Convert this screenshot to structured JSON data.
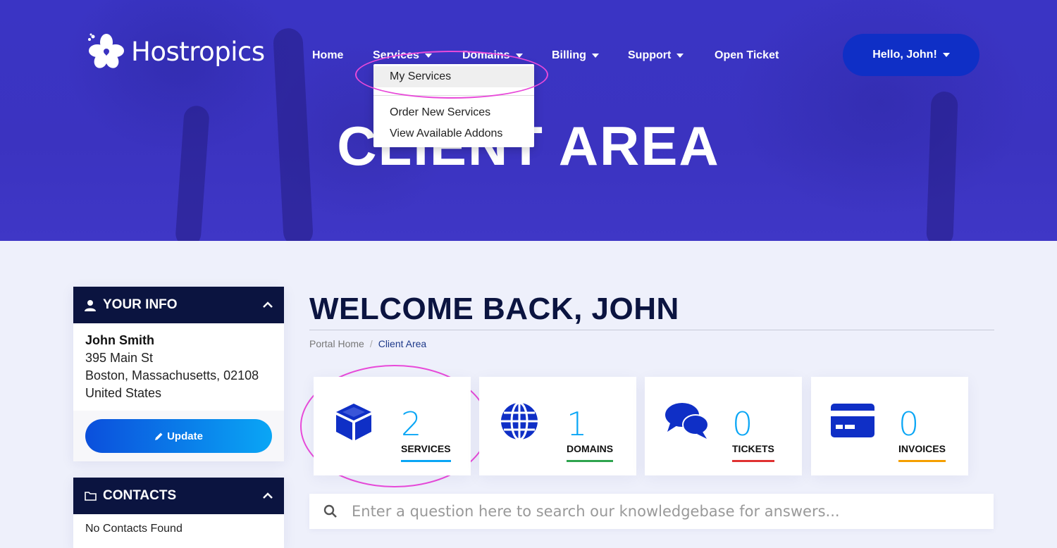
{
  "brand": {
    "name": "Hostropics"
  },
  "nav": {
    "home": "Home",
    "services": "Services",
    "domains": "Domains",
    "billing": "Billing",
    "support": "Support",
    "open_ticket": "Open Ticket",
    "user_menu": "Hello, John!"
  },
  "hero": {
    "title": "CLIENT AREA"
  },
  "services_dropdown": {
    "items": [
      "My Services",
      "Order New Services",
      "View Available Addons"
    ]
  },
  "sidebar": {
    "your_info": {
      "title": "YOUR INFO",
      "name": "John Smith",
      "address1": "395 Main St",
      "address2": "Boston, Massachusetts, 02108",
      "country": "United States",
      "update_label": "Update"
    },
    "contacts": {
      "title": "CONTACTS",
      "empty_text": "No Contacts Found"
    }
  },
  "main": {
    "welcome": "WELCOME BACK, JOHN",
    "breadcrumb": [
      "Portal Home",
      "Client Area"
    ],
    "stats": [
      {
        "number": "2",
        "label": "SERVICES",
        "color": "#0aa6f5",
        "icon": "box-icon"
      },
      {
        "number": "1",
        "label": "DOMAINS",
        "color": "#2ea44f",
        "icon": "globe-icon"
      },
      {
        "number": "0",
        "label": "TICKETS",
        "color": "#e03131",
        "icon": "chat-bubbles-icon"
      },
      {
        "number": "0",
        "label": "INVOICES",
        "color": "#f59f00",
        "icon": "credit-card-icon"
      }
    ],
    "search_placeholder": "Enter a question here to search our knowledgebase for answers..."
  },
  "colors": {
    "hero_bg": "#3b33c0",
    "accent_blue": "#0f2fc6",
    "navy": "#0b1440",
    "highlight": "#e84ad9"
  }
}
